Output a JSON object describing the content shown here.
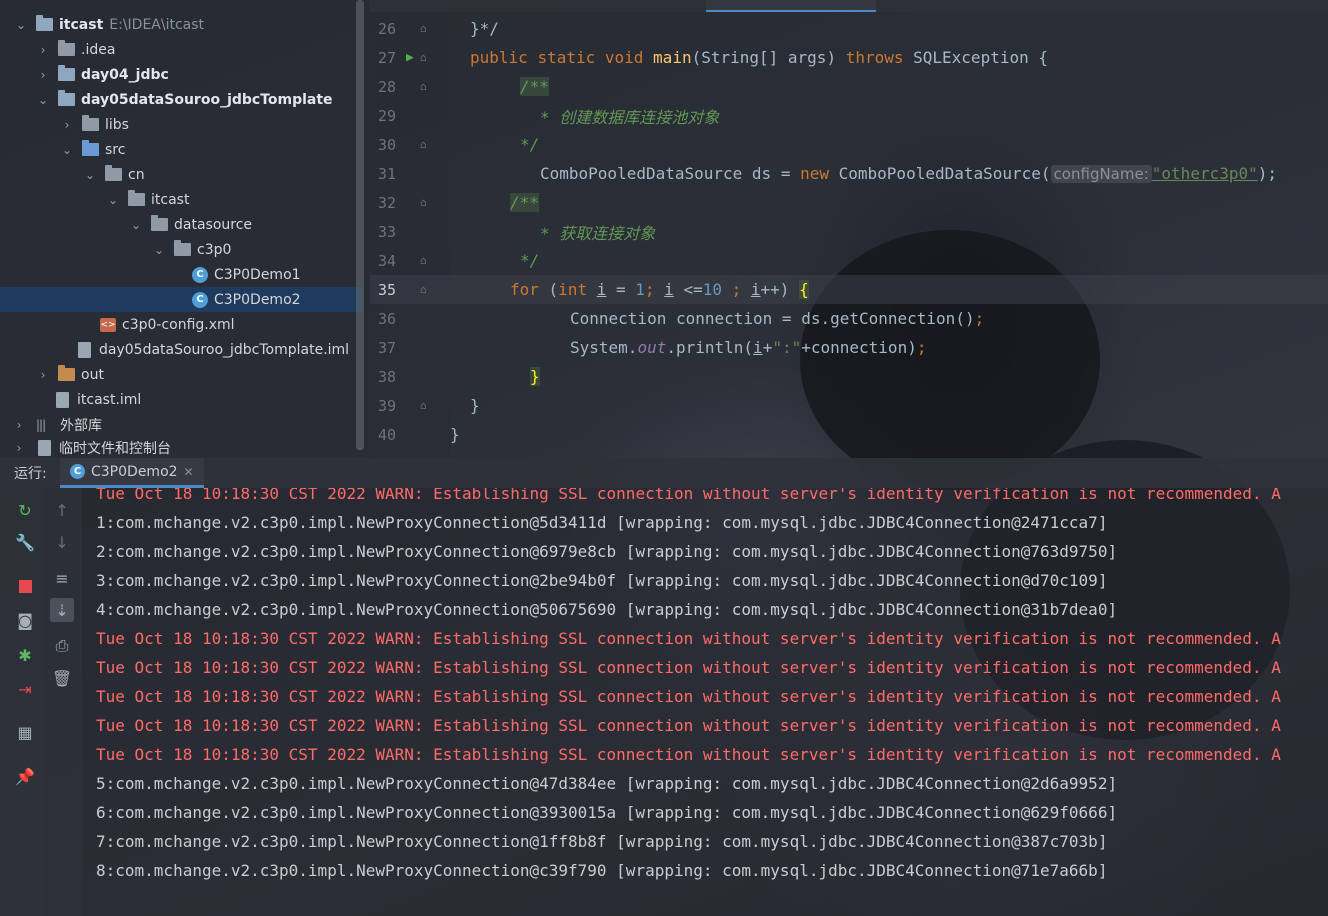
{
  "project_tree": {
    "root": {
      "label": "itcast",
      "path": "E:\\IDEA\\itcast"
    },
    "items": [
      {
        "label": ".idea"
      },
      {
        "label": "day04_jdbc"
      },
      {
        "label": "day05dataSouroo_jdbcTomplate"
      },
      {
        "label": "libs"
      },
      {
        "label": "src"
      },
      {
        "label": "cn"
      },
      {
        "label": "itcast"
      },
      {
        "label": "datasource"
      },
      {
        "label": "c3p0"
      },
      {
        "label": "C3P0Demo1"
      },
      {
        "label": "C3P0Demo2"
      },
      {
        "label": "c3p0-config.xml"
      },
      {
        "label": "day05dataSouroo_jdbcTomplate.iml"
      },
      {
        "label": "out"
      },
      {
        "label": "itcast.iml"
      },
      {
        "label": "外部库"
      },
      {
        "label": "临时文件和控制台"
      }
    ]
  },
  "editor": {
    "current_line": "35",
    "lines": [
      {
        "no": "26"
      },
      {
        "no": "27"
      },
      {
        "no": "28"
      },
      {
        "no": "29"
      },
      {
        "no": "30"
      },
      {
        "no": "31"
      },
      {
        "no": "32"
      },
      {
        "no": "33"
      },
      {
        "no": "34"
      },
      {
        "no": "35"
      },
      {
        "no": "36"
      },
      {
        "no": "37"
      },
      {
        "no": "38"
      },
      {
        "no": "39"
      },
      {
        "no": "40"
      }
    ],
    "code": {
      "l26": "}*/",
      "l27_public": "public",
      "l27_static": "static",
      "l27_void": "void",
      "l27_main": "main",
      "l27_args": "(String[] args) ",
      "l27_throws": "throws",
      "l27_ex": " SQLException {",
      "l28": "/**",
      "l29": "* 创建数据库连接池对象",
      "l30": "*/",
      "l31_a": "ComboPooledDataSource ds = ",
      "l31_new": "new",
      "l31_b": " ComboPooledDataSource(",
      "l31_hint": "configName:",
      "l31_str": "\"otherc3p0\"",
      "l31_c": ");",
      "l32": "/**",
      "l33": "* 获取连接对象",
      "l34": "*/",
      "l35_for": "for",
      "l35_open": " (",
      "l35_int": "int",
      "l35_i1": "i",
      "l35_eq": " = ",
      "l35_1": "1",
      "l35_semi1": "; ",
      "l35_i2": "i",
      "l35_le": " <=",
      "l35_10": "10",
      "l35_semi2": " ; ",
      "l35_i3": "i",
      "l35_inc": "++) ",
      "l35_brace": "{",
      "l36_a": "Connection connection = ds.getConnection()",
      "l36_semi": ";",
      "l37_a": "System.",
      "l37_out": "out",
      "l37_b": ".println(",
      "l37_i": "i",
      "l37_c": "+",
      "l37_str": "\":\"",
      "l37_d": "+connection)",
      "l37_semi": ";",
      "l38": "}",
      "l39": "}",
      "l40": "}"
    }
  },
  "run_window": {
    "label": "运行:",
    "tab": "C3P0Demo2",
    "console": [
      {
        "type": "warn",
        "text": "Tue Oct 18 10:18:30 CST 2022 WARN: Establishing SSL connection without server's identity verification is not recommended. A"
      },
      {
        "type": "info",
        "text": "1:com.mchange.v2.c3p0.impl.NewProxyConnection@5d3411d [wrapping: com.mysql.jdbc.JDBC4Connection@2471cca7]"
      },
      {
        "type": "info",
        "text": "2:com.mchange.v2.c3p0.impl.NewProxyConnection@6979e8cb [wrapping: com.mysql.jdbc.JDBC4Connection@763d9750]"
      },
      {
        "type": "info",
        "text": "3:com.mchange.v2.c3p0.impl.NewProxyConnection@2be94b0f [wrapping: com.mysql.jdbc.JDBC4Connection@d70c109]"
      },
      {
        "type": "info",
        "text": "4:com.mchange.v2.c3p0.impl.NewProxyConnection@50675690 [wrapping: com.mysql.jdbc.JDBC4Connection@31b7dea0]"
      },
      {
        "type": "warn",
        "text": "Tue Oct 18 10:18:30 CST 2022 WARN: Establishing SSL connection without server's identity verification is not recommended. A"
      },
      {
        "type": "warn",
        "text": "Tue Oct 18 10:18:30 CST 2022 WARN: Establishing SSL connection without server's identity verification is not recommended. A"
      },
      {
        "type": "warn",
        "text": "Tue Oct 18 10:18:30 CST 2022 WARN: Establishing SSL connection without server's identity verification is not recommended. A"
      },
      {
        "type": "warn",
        "text": "Tue Oct 18 10:18:30 CST 2022 WARN: Establishing SSL connection without server's identity verification is not recommended. A"
      },
      {
        "type": "warn",
        "text": "Tue Oct 18 10:18:30 CST 2022 WARN: Establishing SSL connection without server's identity verification is not recommended. A"
      },
      {
        "type": "info",
        "text": "5:com.mchange.v2.c3p0.impl.NewProxyConnection@47d384ee [wrapping: com.mysql.jdbc.JDBC4Connection@2d6a9952]"
      },
      {
        "type": "info",
        "text": "6:com.mchange.v2.c3p0.impl.NewProxyConnection@3930015a [wrapping: com.mysql.jdbc.JDBC4Connection@629f0666]"
      },
      {
        "type": "info",
        "text": "7:com.mchange.v2.c3p0.impl.NewProxyConnection@1ff8b8f [wrapping: com.mysql.jdbc.JDBC4Connection@387c703b]"
      },
      {
        "type": "info",
        "text": "8:com.mchange.v2.c3p0.impl.NewProxyConnection@c39f790 [wrapping: com.mysql.jdbc.JDBC4Connection@71e7a66b]"
      }
    ]
  },
  "colors": {
    "keyword": "#cc7832",
    "comment": "#629755",
    "string": "#6a8759",
    "number": "#6897bb",
    "warn": "#ff6b68",
    "selection": "#1e3a5c"
  },
  "icons": {
    "rerun": "rerun-icon",
    "settings": "wrench-icon",
    "stop": "stop-icon",
    "camera": "camera-icon",
    "debug": "debug-icon",
    "exit": "exit-icon",
    "layout": "layout-icon",
    "pin": "pin-icon",
    "up": "arrow-up-icon",
    "down": "arrow-down-icon",
    "wrap": "soft-wrap-icon",
    "scroll_end": "scroll-to-end-icon",
    "print": "print-icon",
    "trash": "trash-icon"
  }
}
